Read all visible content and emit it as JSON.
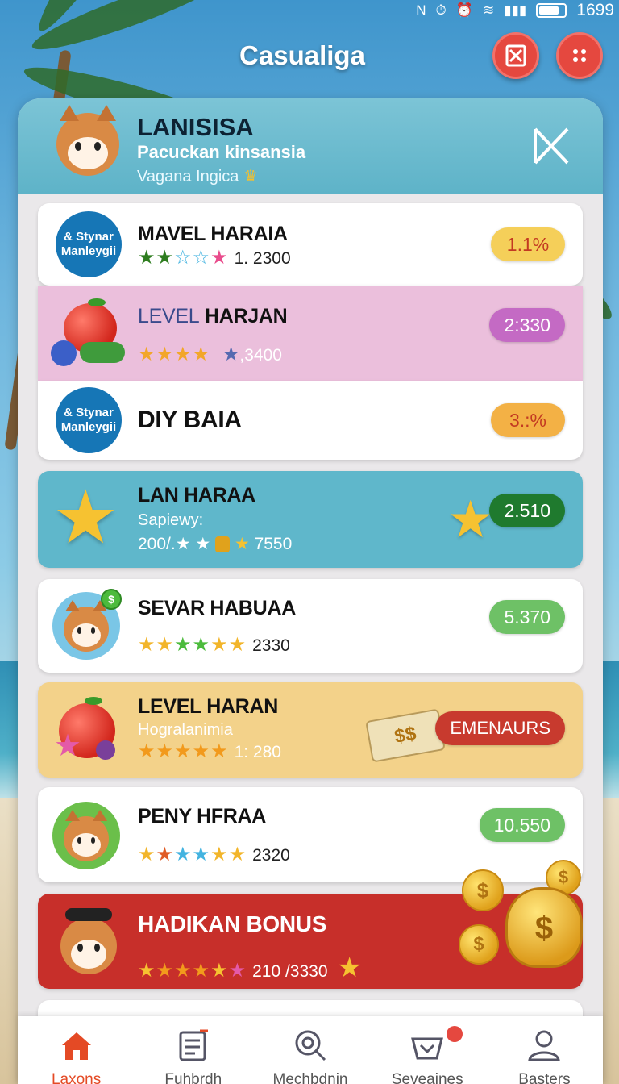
{
  "status_bar": {
    "time": "1699"
  },
  "app": {
    "title": "Casualiga"
  },
  "header": {
    "title": "LANISISA",
    "subtitle": "Pacuckan kinsansia",
    "caption": "Vagana Ingica"
  },
  "rows": [
    {
      "title": "MAVEL HARAIA",
      "score": "1. 2300",
      "badge": "1.1%",
      "logo": "& Stynar Manleygii"
    },
    {
      "title_prefix": "LEVEL",
      "title_rest": " HARJAN",
      "score": ",3400",
      "badge": "2:330"
    },
    {
      "title": "DIY BAIA",
      "badge": "3.:%",
      "logo": "& Stynar Manleygii"
    },
    {
      "title": "LAN HARAA",
      "subtitle": "Sapiewy:",
      "meta": "200/.★ ★",
      "score": "7550",
      "badge": "2.510"
    },
    {
      "title": "SEVAR HABUAA",
      "score": "2330",
      "badge": "5.370"
    },
    {
      "title": "LEVEL HARAN",
      "subtitle": "Hogralanimia",
      "score": "1: 280",
      "badge": "EMENAURS"
    },
    {
      "title": "PENY HFRAA",
      "score": "2320",
      "badge": "10.550"
    },
    {
      "title": "HADIKAN BONUS",
      "score": "210 /3330"
    }
  ],
  "nav": [
    {
      "label": "Laxons",
      "icon": "home-icon"
    },
    {
      "label": "Fuhbrdh",
      "icon": "notes-icon"
    },
    {
      "label": "Mechbdnin",
      "icon": "search-target-icon"
    },
    {
      "label": "Seveaines",
      "icon": "basket-icon"
    },
    {
      "label": "Basters",
      "icon": "profile-icon"
    }
  ],
  "colors": {
    "accent_red": "#e5483f",
    "header_teal": "#5eb3c8",
    "pink_row": "#ebbfdc",
    "teal_row": "#5fb7cb",
    "gold_row": "#f3d28a",
    "bonus_red": "#c72f2a"
  }
}
